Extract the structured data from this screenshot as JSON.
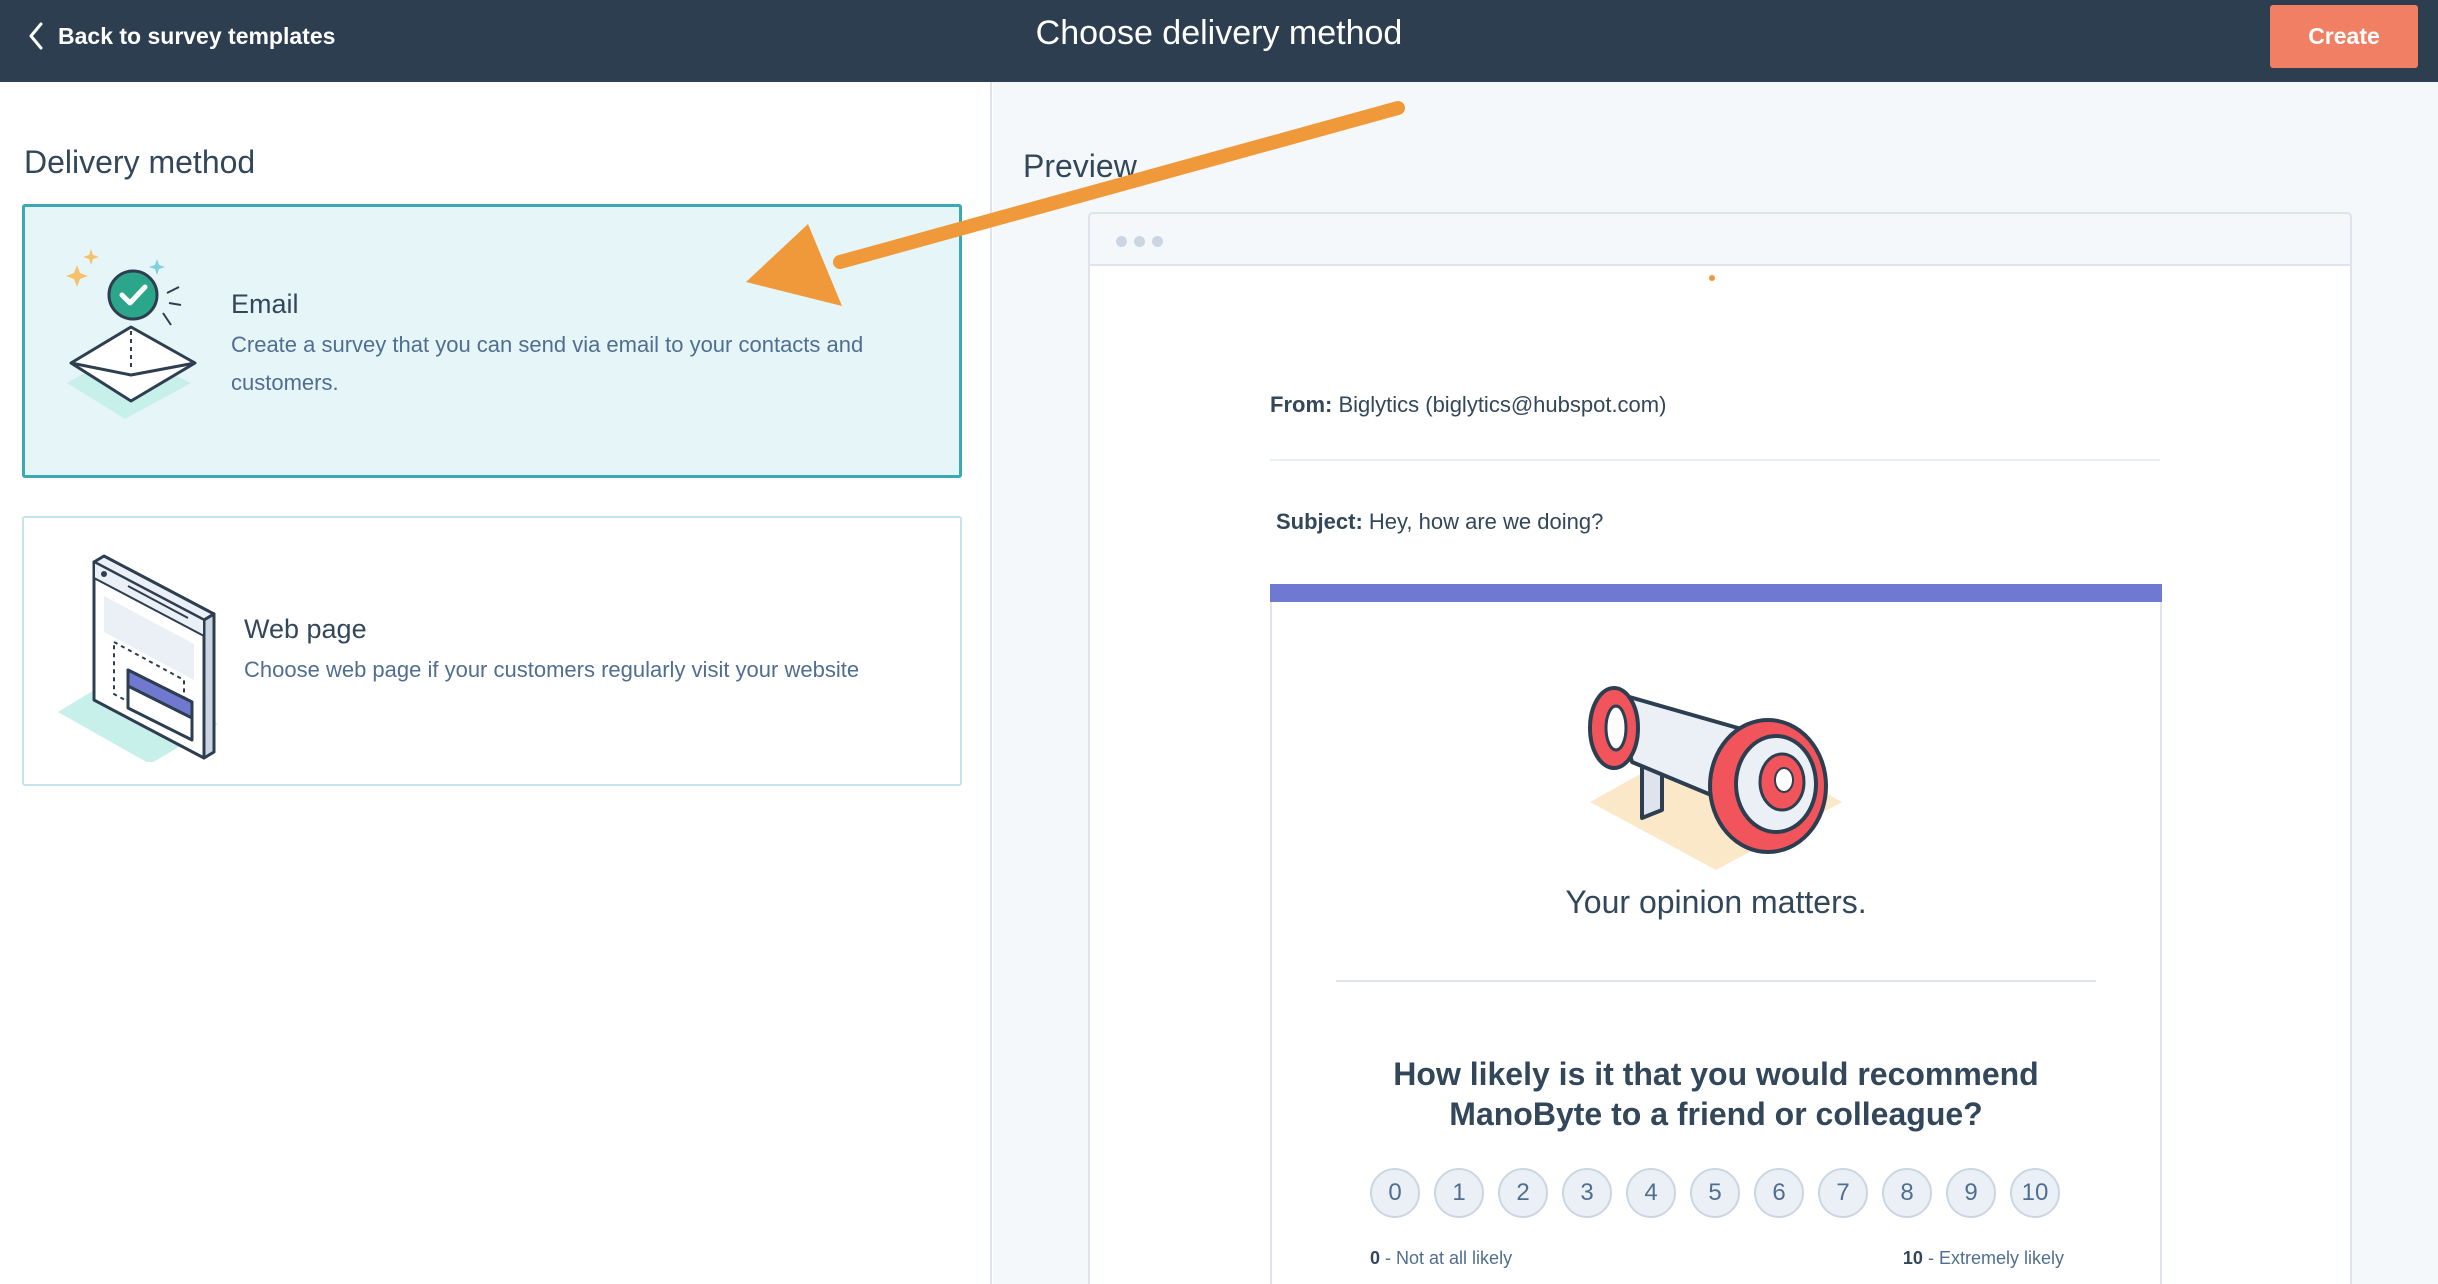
{
  "topbar": {
    "back_label": "Back to survey templates",
    "title": "Choose delivery method",
    "create_label": "Create"
  },
  "left": {
    "section_title": "Delivery method",
    "options": [
      {
        "heading": "Email",
        "description": "Create a survey that you can send via email to your contacts and customers.",
        "selected": true
      },
      {
        "heading": "Web page",
        "description": "Choose web page if your customers regularly visit your website",
        "selected": false
      }
    ]
  },
  "preview": {
    "title": "Preview",
    "from_label": "From:",
    "from_value": "Biglytics (biglytics@hubspot.com)",
    "subject_label": "Subject:",
    "subject_value": "Hey, how are we doing?",
    "opinion_text": "Your opinion matters.",
    "question_line1": "How likely is it that you would recommend",
    "question_line2": "ManoByte to a friend or colleague?",
    "scale": [
      "0",
      "1",
      "2",
      "3",
      "4",
      "5",
      "6",
      "7",
      "8",
      "9",
      "10"
    ],
    "low_num": "0",
    "low_text": "- Not at all likely",
    "high_num": "10",
    "high_text": "- Extremely likely"
  },
  "colors": {
    "topbar": "#2d3e50",
    "accent_create": "#f07f63",
    "selected_border": "#3aa8b5",
    "survey_band": "#7079d1",
    "annotation_arrow": "#f0993a"
  },
  "icons": [
    "chevron-left-icon",
    "email-envelope-icon",
    "web-page-icon",
    "megaphone-icon",
    "annotation-arrow"
  ]
}
